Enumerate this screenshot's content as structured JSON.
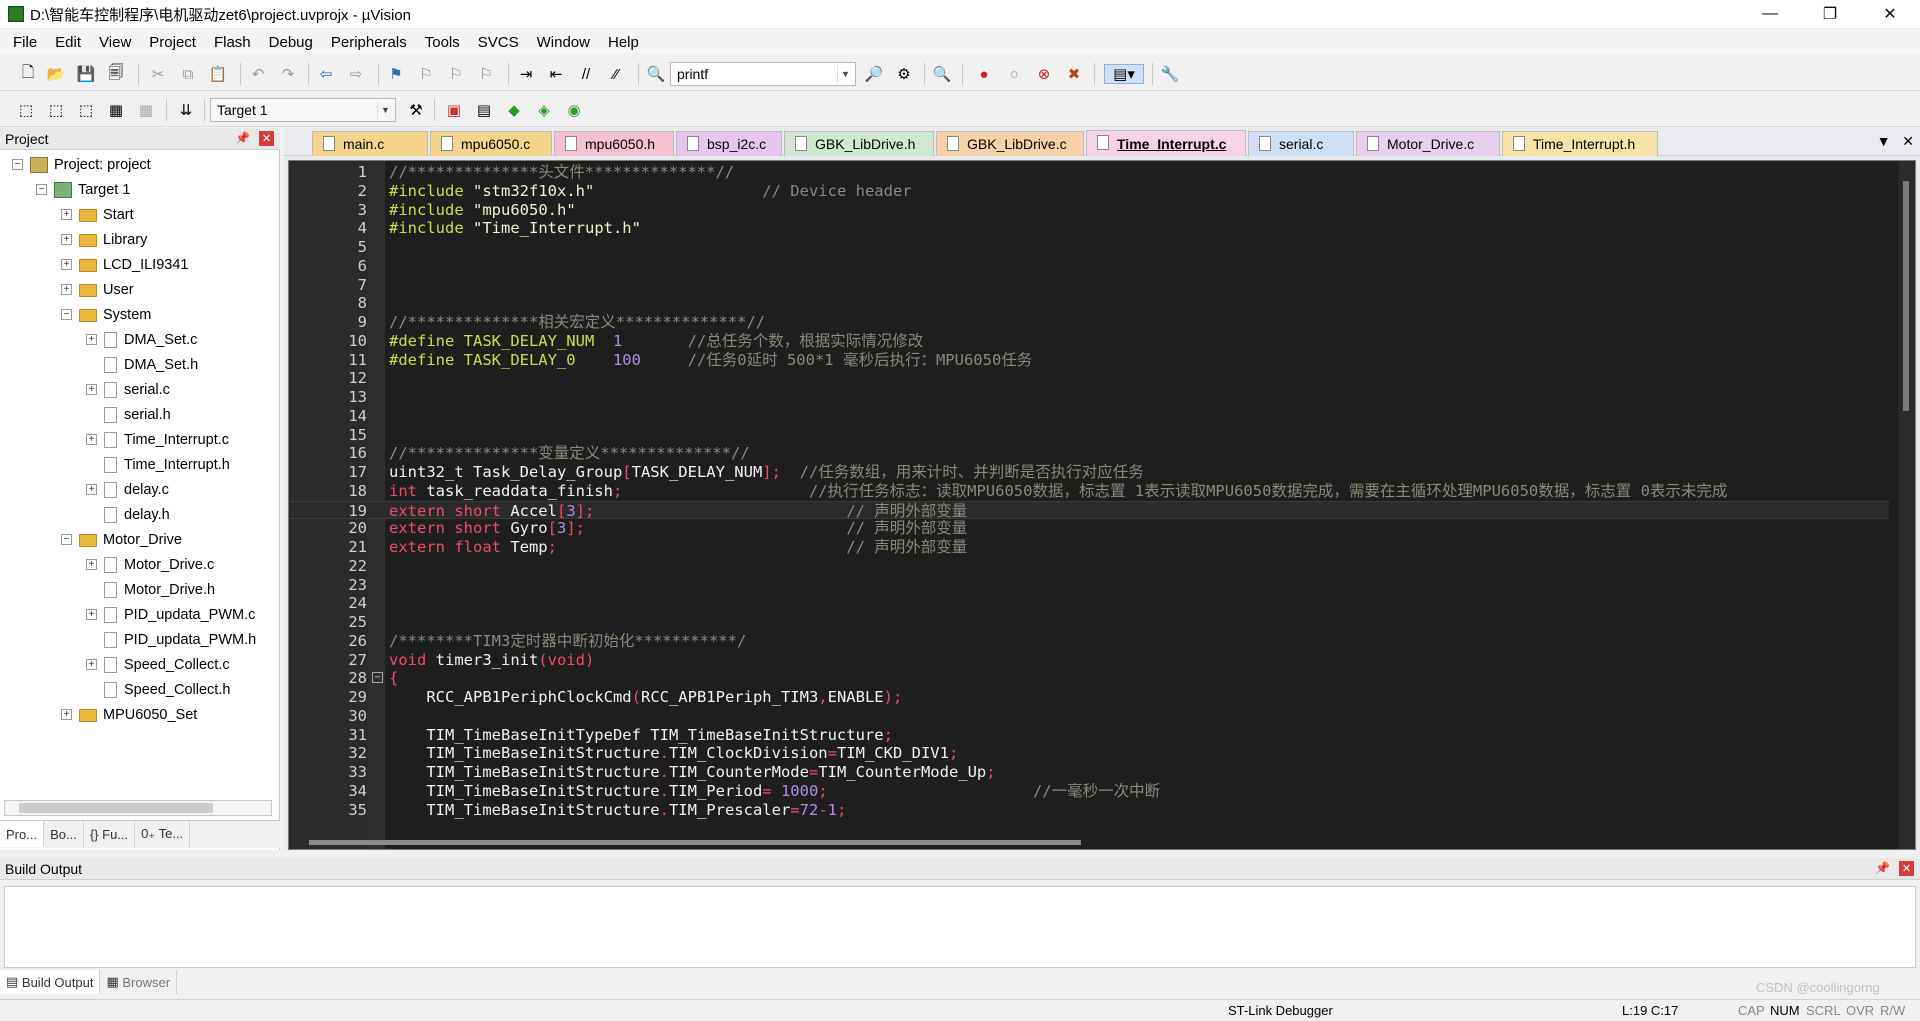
{
  "window": {
    "title": "D:\\智能车控制程序\\电机驱动zet6\\project.uvprojx - µVision",
    "controls": [
      "—",
      "❐",
      "✕"
    ]
  },
  "menu": [
    "File",
    "Edit",
    "View",
    "Project",
    "Flash",
    "Debug",
    "Peripherals",
    "Tools",
    "SVCS",
    "Window",
    "Help"
  ],
  "toolbar": {
    "find_value": "printf",
    "target_value": "Target 1"
  },
  "project_panel": {
    "title": "Project",
    "tree": [
      {
        "label": "Project: project",
        "type": "project"
      },
      {
        "label": "Target 1",
        "type": "target"
      },
      {
        "label": "Start",
        "type": "folder"
      },
      {
        "label": "Library",
        "type": "folder"
      },
      {
        "label": "LCD_ILI9341",
        "type": "folder"
      },
      {
        "label": "User",
        "type": "folder"
      },
      {
        "label": "System",
        "type": "folder"
      },
      {
        "label": "DMA_Set.c",
        "type": "file"
      },
      {
        "label": "DMA_Set.h",
        "type": "file"
      },
      {
        "label": "serial.c",
        "type": "file"
      },
      {
        "label": "serial.h",
        "type": "file"
      },
      {
        "label": "Time_Interrupt.c",
        "type": "file"
      },
      {
        "label": "Time_Interrupt.h",
        "type": "file"
      },
      {
        "label": "delay.c",
        "type": "file"
      },
      {
        "label": "delay.h",
        "type": "file"
      },
      {
        "label": "Motor_Drive",
        "type": "folder"
      },
      {
        "label": "Motor_Drive.c",
        "type": "file"
      },
      {
        "label": "Motor_Drive.h",
        "type": "file"
      },
      {
        "label": "PID_updata_PWM.c",
        "type": "file"
      },
      {
        "label": "PID_updata_PWM.h",
        "type": "file"
      },
      {
        "label": "Speed_Collect.c",
        "type": "file"
      },
      {
        "label": "Speed_Collect.h",
        "type": "file"
      },
      {
        "label": "MPU6050_Set",
        "type": "folder"
      }
    ],
    "bottom_tabs": [
      "Pro...",
      "Bo...",
      "{} Fu...",
      "0₊ Te..."
    ]
  },
  "editor": {
    "tabs": [
      {
        "label": "main.c",
        "color": "#f5d58a"
      },
      {
        "label": "mpu6050.c",
        "color": "#f5d58a"
      },
      {
        "label": "mpu6050.h",
        "color": "#f6c2cf"
      },
      {
        "label": "bsp_i2c.c",
        "color": "#e6c6ee"
      },
      {
        "label": "GBK_LibDrive.h",
        "color": "#cfe8cf"
      },
      {
        "label": "GBK_LibDrive.c",
        "color": "#f7d2a8"
      },
      {
        "label": "Time_Interrupt.c",
        "color": "#f6d4e4",
        "active": true
      },
      {
        "label": "serial.c",
        "color": "#cfe0f4"
      },
      {
        "label": "Motor_Drive.c",
        "color": "#e6d0ee"
      },
      {
        "label": "Time_Interrupt.h",
        "color": "#f5e4a8"
      }
    ],
    "lines": [
      {
        "n": "1",
        "segs": [
          [
            "cm",
            "//**************头文件**************//"
          ]
        ]
      },
      {
        "n": "2",
        "segs": [
          [
            "pp",
            "#include "
          ],
          [
            "str",
            "\"stm32f10x.h\""
          ],
          [
            "id",
            "                  "
          ],
          [
            "cm",
            "// Device header"
          ]
        ]
      },
      {
        "n": "3",
        "segs": [
          [
            "pp",
            "#include "
          ],
          [
            "str",
            "\"mpu6050.h\""
          ]
        ]
      },
      {
        "n": "4",
        "segs": [
          [
            "pp",
            "#include "
          ],
          [
            "str",
            "\"Time_Interrupt.h\""
          ]
        ]
      },
      {
        "n": "5",
        "segs": []
      },
      {
        "n": "6",
        "segs": []
      },
      {
        "n": "7",
        "segs": []
      },
      {
        "n": "8",
        "segs": []
      },
      {
        "n": "9",
        "segs": [
          [
            "cm",
            "//**************相关宏定义**************//"
          ]
        ]
      },
      {
        "n": "10",
        "segs": [
          [
            "pp",
            "#define TASK_DELAY_NUM  "
          ],
          [
            "num",
            "1"
          ],
          [
            "id",
            "       "
          ],
          [
            "cm",
            "//总任务个数，根据实际情况修改"
          ]
        ]
      },
      {
        "n": "11",
        "segs": [
          [
            "pp",
            "#define TASK_DELAY_0    "
          ],
          [
            "num",
            "100"
          ],
          [
            "id",
            "     "
          ],
          [
            "cm",
            "//任务0延时 500*1 毫秒后执行：MPU6050任务"
          ]
        ]
      },
      {
        "n": "12",
        "segs": []
      },
      {
        "n": "13",
        "segs": []
      },
      {
        "n": "14",
        "segs": []
      },
      {
        "n": "15",
        "segs": []
      },
      {
        "n": "16",
        "segs": [
          [
            "cm",
            "//**************变量定义**************//"
          ]
        ]
      },
      {
        "n": "17",
        "segs": [
          [
            "id",
            "uint32_t Task_Delay_Group"
          ],
          [
            "kw",
            "["
          ],
          [
            "id",
            "TASK_DELAY_NUM"
          ],
          [
            "kw",
            "];"
          ],
          [
            "id",
            "  "
          ],
          [
            "cm",
            "//任务数组，用来计时、并判断是否执行对应任务"
          ]
        ]
      },
      {
        "n": "18",
        "segs": [
          [
            "kw",
            "int"
          ],
          [
            "id",
            " task_readdata_finish"
          ],
          [
            "kw",
            ";"
          ],
          [
            "id",
            "                    "
          ],
          [
            "cm",
            "//执行任务标志：读取MPU6050数据，标志置 1表示读取MPU6050数据完成，需要在主循环处理MPU6050数据，标志置 0表示未完成"
          ]
        ]
      },
      {
        "n": "19",
        "segs": [
          [
            "kw",
            "extern short"
          ],
          [
            "id",
            " Accel"
          ],
          [
            "kw",
            "["
          ],
          [
            "num",
            "3"
          ],
          [
            "kw",
            "];"
          ],
          [
            "id",
            "                           "
          ],
          [
            "cm",
            "// 声明外部变量"
          ]
        ],
        "current": true
      },
      {
        "n": "20",
        "segs": [
          [
            "kw",
            "extern short"
          ],
          [
            "id",
            " Gyro"
          ],
          [
            "kw",
            "["
          ],
          [
            "num",
            "3"
          ],
          [
            "kw",
            "];"
          ],
          [
            "id",
            "                            "
          ],
          [
            "cm",
            "// 声明外部变量"
          ]
        ]
      },
      {
        "n": "21",
        "segs": [
          [
            "kw",
            "extern float"
          ],
          [
            "id",
            " Temp"
          ],
          [
            "kw",
            ";"
          ],
          [
            "id",
            "                               "
          ],
          [
            "cm",
            "// 声明外部变量"
          ]
        ]
      },
      {
        "n": "22",
        "segs": []
      },
      {
        "n": "23",
        "segs": []
      },
      {
        "n": "24",
        "segs": []
      },
      {
        "n": "25",
        "segs": []
      },
      {
        "n": "26",
        "segs": [
          [
            "cm",
            "/********TIM3定时器中断初始化***********/"
          ]
        ]
      },
      {
        "n": "27",
        "segs": [
          [
            "kw",
            "void"
          ],
          [
            "id",
            " timer3_init"
          ],
          [
            "kw",
            "(void)"
          ]
        ]
      },
      {
        "n": "28",
        "segs": [
          [
            "kw",
            "{"
          ]
        ],
        "fold": true
      },
      {
        "n": "29",
        "segs": [
          [
            "id",
            "    RCC_APB1PeriphClockCmd"
          ],
          [
            "kw",
            "("
          ],
          [
            "id",
            "RCC_APB1Periph_TIM3"
          ],
          [
            "kw",
            ","
          ],
          [
            "id",
            "ENABLE"
          ],
          [
            "kw",
            ");"
          ]
        ]
      },
      {
        "n": "30",
        "segs": []
      },
      {
        "n": "31",
        "segs": [
          [
            "id",
            "    TIM_TimeBaseInitTypeDef TIM_TimeBaseInitStructure"
          ],
          [
            "kw",
            ";"
          ]
        ]
      },
      {
        "n": "32",
        "segs": [
          [
            "id",
            "    TIM_TimeBaseInitStructure"
          ],
          [
            "kw",
            "."
          ],
          [
            "id",
            "TIM_ClockDivision"
          ],
          [
            "kw",
            "="
          ],
          [
            "id",
            "TIM_CKD_DIV1"
          ],
          [
            "kw",
            ";"
          ]
        ]
      },
      {
        "n": "33",
        "segs": [
          [
            "id",
            "    TIM_TimeBaseInitStructure"
          ],
          [
            "kw",
            "."
          ],
          [
            "id",
            "TIM_CounterMode"
          ],
          [
            "kw",
            "="
          ],
          [
            "id",
            "TIM_CounterMode_Up"
          ],
          [
            "kw",
            ";"
          ]
        ]
      },
      {
        "n": "34",
        "segs": [
          [
            "id",
            "    TIM_TimeBaseInitStructure"
          ],
          [
            "kw",
            "."
          ],
          [
            "id",
            "TIM_Period"
          ],
          [
            "kw",
            "= "
          ],
          [
            "num",
            "1000"
          ],
          [
            "kw",
            ";"
          ],
          [
            "id",
            "                      "
          ],
          [
            "cm",
            "//一毫秒一次中断"
          ]
        ]
      },
      {
        "n": "35",
        "segs": [
          [
            "id",
            "    TIM_TimeBaseInitStructure"
          ],
          [
            "kw",
            "."
          ],
          [
            "id",
            "TIM_Prescaler"
          ],
          [
            "kw",
            "="
          ],
          [
            "num",
            "72"
          ],
          [
            "kw",
            "-"
          ],
          [
            "num",
            "1"
          ],
          [
            "kw",
            ";"
          ]
        ]
      }
    ]
  },
  "build_output": {
    "title": "Build Output",
    "tabs": [
      "Build Output",
      "Browser"
    ]
  },
  "status": {
    "debugger": "ST-Link Debugger",
    "position": "L:19 C:17",
    "caps": "CAP",
    "num": "NUM",
    "scrl": "SCRL",
    "ovr": "OVR",
    "rw": "R/W",
    "watermark": "CSDN @coollingorng"
  }
}
